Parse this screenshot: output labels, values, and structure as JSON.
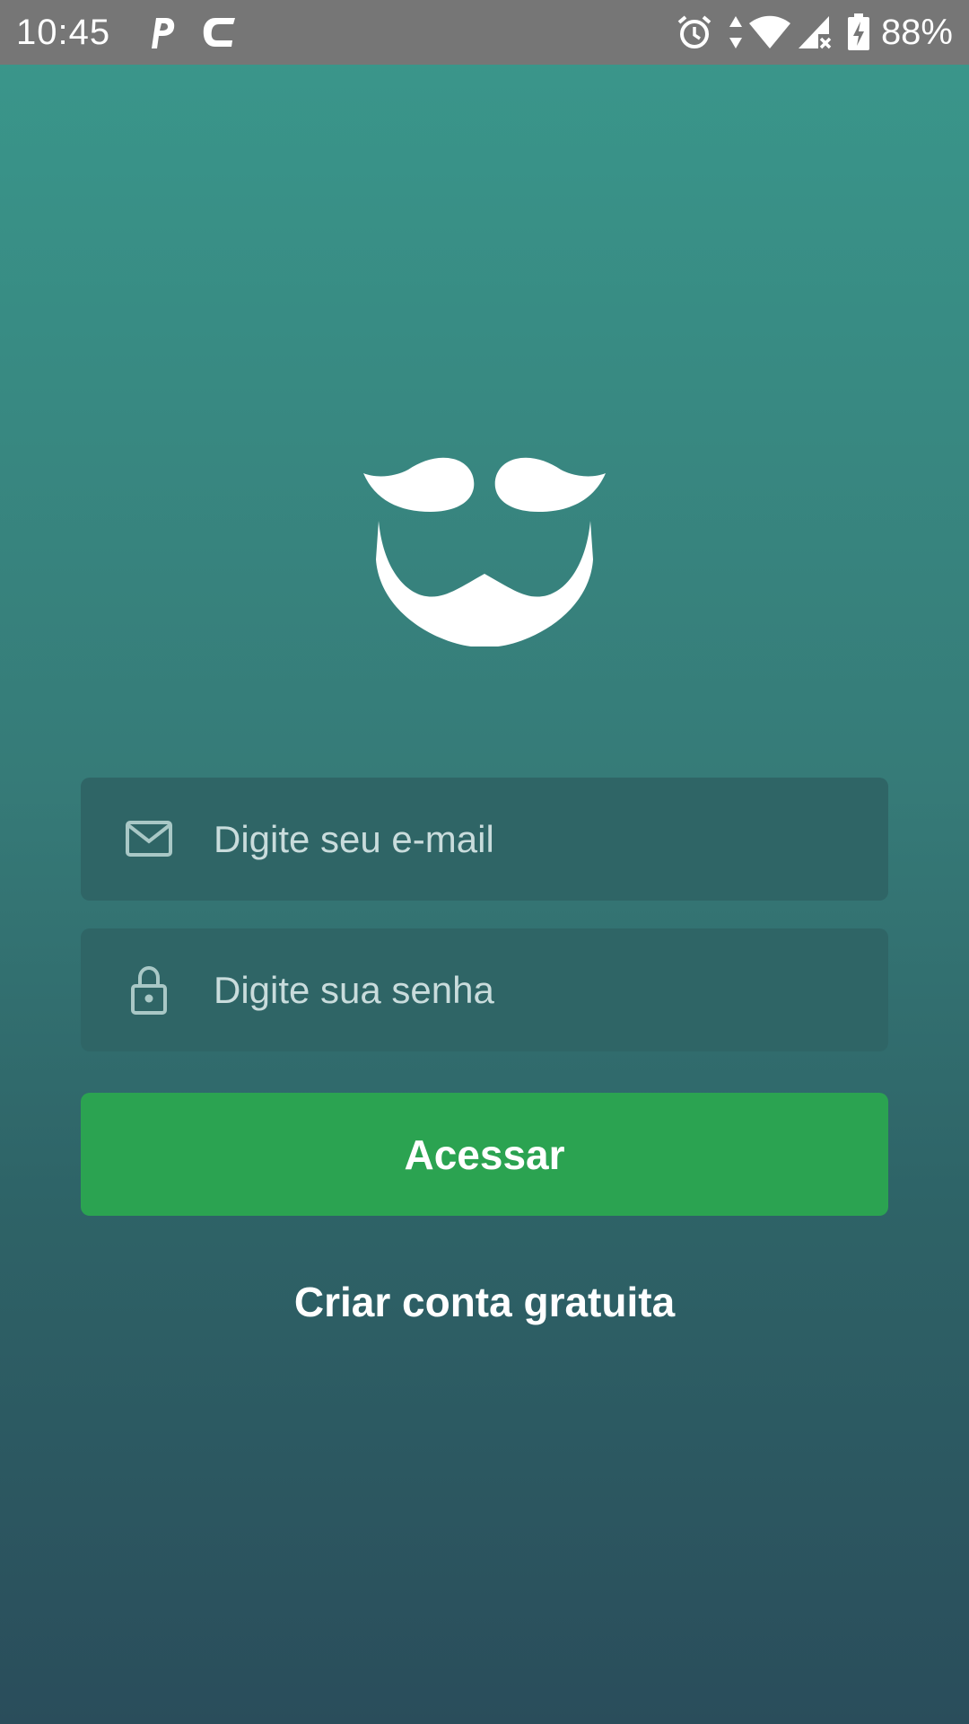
{
  "status_bar": {
    "time": "10:45",
    "battery_percent": "88%",
    "icons": [
      "p-app-icon",
      "c-app-icon",
      "alarm-icon",
      "data-arrows-icon",
      "wifi-icon",
      "signal-icon",
      "battery-charging-icon"
    ]
  },
  "logo": {
    "icon": "mustache-beard-logo"
  },
  "login": {
    "email_placeholder": "Digite seu e-mail",
    "password_placeholder": "Digite sua senha",
    "submit_label": "Acessar",
    "create_account_label": "Criar conta gratuita"
  },
  "colors": {
    "background_top": "#3a988c",
    "background_bottom": "#2a4d5b",
    "status_bar": "#767676",
    "input_background": "#2f6566",
    "button": "#2ba351",
    "text_light": "#ffffff"
  }
}
